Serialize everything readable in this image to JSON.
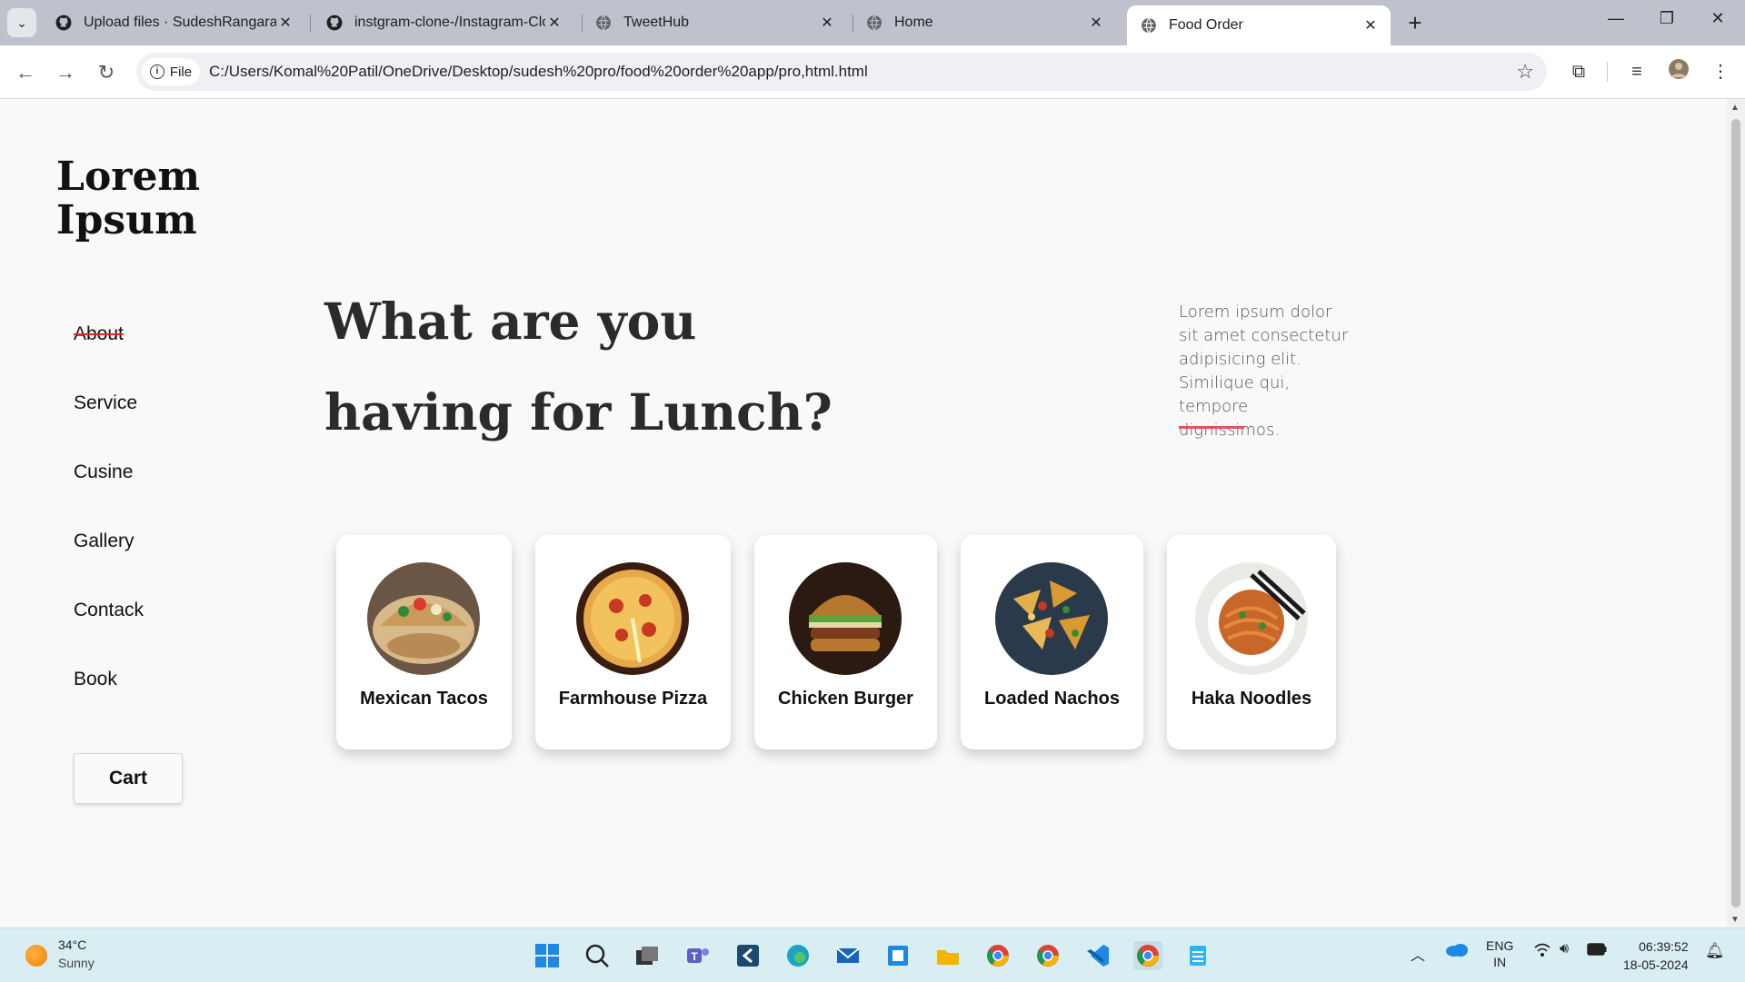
{
  "browser": {
    "tabs": [
      {
        "title": "Upload files · SudeshRangaraoP",
        "icon": "github-icon",
        "active": false
      },
      {
        "title": "instgram-clone-/Instagram-Clo",
        "icon": "github-icon",
        "active": false
      },
      {
        "title": "TweetHub",
        "icon": "globe-icon",
        "active": false
      },
      {
        "title": "Home",
        "icon": "globe-icon",
        "active": false
      },
      {
        "title": "Food Order",
        "icon": "globe-icon",
        "active": true
      }
    ],
    "file_chip": "File",
    "url": "C:/Users/Komal%20Patil/OneDrive/Desktop/sudesh%20pro/food%20order%20app/pro,html.html"
  },
  "page": {
    "logo": "Lorem Ipsum",
    "nav": [
      {
        "label": "About",
        "struck": true
      },
      {
        "label": "Service"
      },
      {
        "label": "Cusine"
      },
      {
        "label": "Gallery"
      },
      {
        "label": "Contack"
      },
      {
        "label": "Book"
      }
    ],
    "cart": "Cart",
    "headline_line1": "What are you",
    "headline_line2": "having for Lunch?",
    "side_text": "Lorem ipsum dolor sit amet consectetur adipisicing elit. Similique qui, tempore dignissimos.",
    "accent_color": "#e2545a",
    "cards": [
      {
        "label": "Mexican Tacos",
        "icon": "taco-photo"
      },
      {
        "label": "Farmhouse Pizza",
        "icon": "pizza-photo"
      },
      {
        "label": "Chicken Burger",
        "icon": "burger-photo"
      },
      {
        "label": "Loaded Nachos",
        "icon": "nachos-photo"
      },
      {
        "label": "Haka Noodles",
        "icon": "noodles-photo"
      }
    ]
  },
  "taskbar": {
    "temp": "34°C",
    "weather": "Sunny",
    "lang1": "ENG",
    "lang2": "IN",
    "time": "06:39:52",
    "date": "18-05-2024"
  }
}
